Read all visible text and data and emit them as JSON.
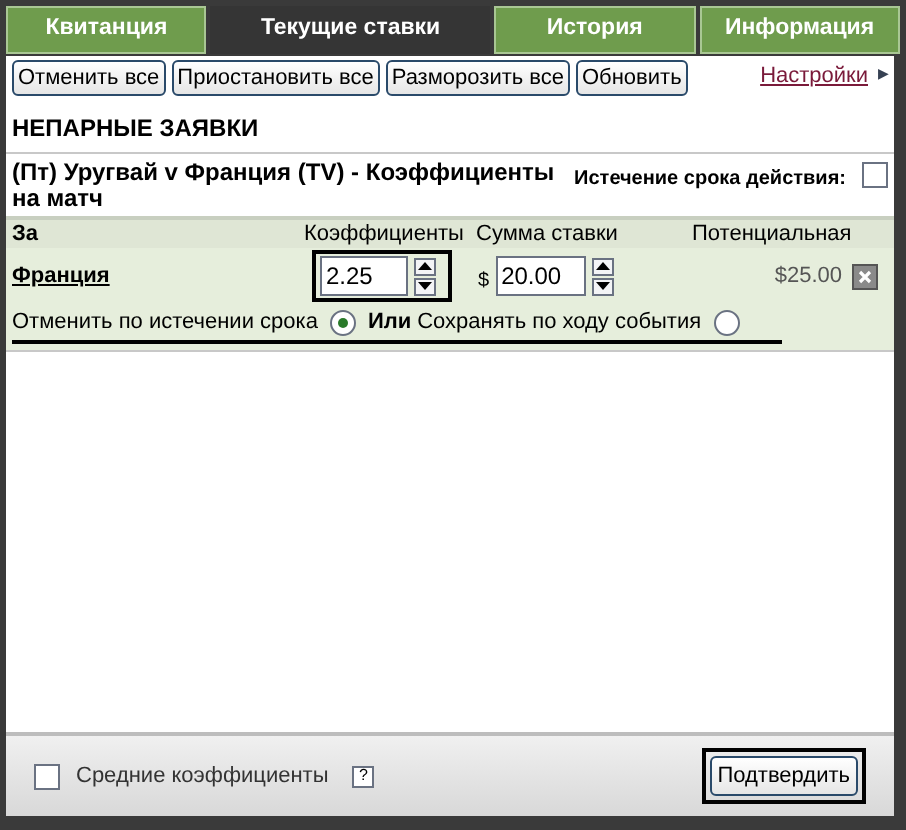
{
  "tabs": [
    {
      "label": "Квитанция",
      "selected": false
    },
    {
      "label": "Текущие ставки",
      "selected": true
    },
    {
      "label": "История",
      "selected": false
    },
    {
      "label": "Информация",
      "selected": false
    }
  ],
  "toolbar": {
    "buttons": [
      "Отменить все",
      "Приостановить все",
      "Разморозить все",
      "Обновить"
    ],
    "settings_link": "Настройки",
    "settings_arrow": "▶"
  },
  "section_title": "НЕПАРНЫЕ ЗАЯВКИ",
  "event": {
    "title": "(Пт) Уругвай v Франция (TV) - Коэффициенты на матч",
    "expiry_label": "Истечение срока действия:",
    "expiry_checked": false
  },
  "table": {
    "columns": [
      "За",
      "Коэффициенты",
      "Сумма ставки",
      "Потенциальная"
    ],
    "rows": [
      {
        "selection": "Франция",
        "odds": "2.25",
        "currency": "$",
        "stake": "20.00",
        "payout": "$25.00"
      }
    ]
  },
  "persistence": {
    "options": [
      {
        "label": "Отменить по истечении срока",
        "selected": true
      },
      {
        "label": "Сохранять по ходу события",
        "selected": false
      }
    ],
    "separator": "Или"
  },
  "footer": {
    "average_odds_label": "Средние коэффициенты",
    "average_odds_checked": false,
    "help": "?",
    "confirm_button": "Подтвердить"
  }
}
